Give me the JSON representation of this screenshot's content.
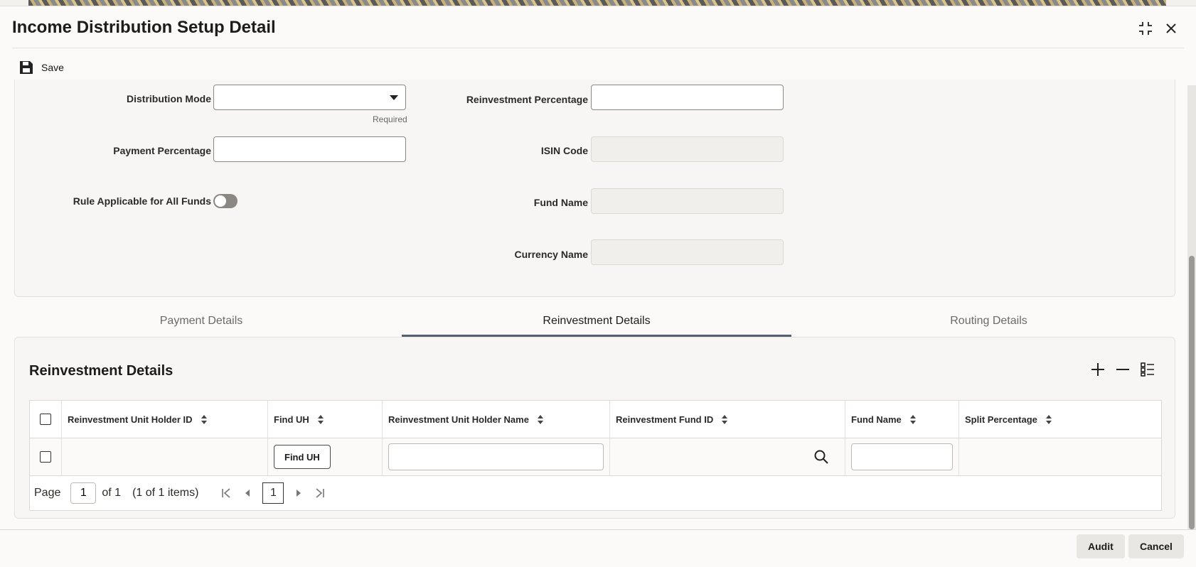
{
  "window": {
    "title": "Income Distribution Setup Detail"
  },
  "toolbar": {
    "save_label": "Save"
  },
  "form": {
    "distribution_mode": {
      "label": "Distribution Mode",
      "value": "",
      "required_label": "Required"
    },
    "payment_percentage": {
      "label": "Payment Percentage",
      "value": ""
    },
    "rule_all_funds": {
      "label": "Rule Applicable for All Funds",
      "on": false
    },
    "reinvestment_percentage": {
      "label": "Reinvestment Percentage",
      "value": ""
    },
    "isin_code": {
      "label": "ISIN Code",
      "value": ""
    },
    "fund_name": {
      "label": "Fund Name",
      "value": ""
    },
    "currency_name": {
      "label": "Currency Name",
      "value": ""
    }
  },
  "tabs": [
    {
      "label": "Payment Details",
      "active": false
    },
    {
      "label": "Reinvestment Details",
      "active": true
    },
    {
      "label": "Routing Details",
      "active": false
    }
  ],
  "grid": {
    "title": "Reinvestment Details",
    "columns": [
      "Reinvestment Unit Holder ID",
      "Find UH",
      "Reinvestment Unit Holder Name",
      "Reinvestment Fund ID",
      "Fund Name",
      "Split Percentage"
    ],
    "rows": [
      {
        "find_uh_label": "Find UH"
      }
    ],
    "pager": {
      "page_label": "Page",
      "page_value": "1",
      "of_label": "of 1",
      "items_label": "(1 of 1 items)",
      "current": "1"
    }
  },
  "footer": {
    "audit_label": "Audit",
    "cancel_label": "Cancel"
  }
}
